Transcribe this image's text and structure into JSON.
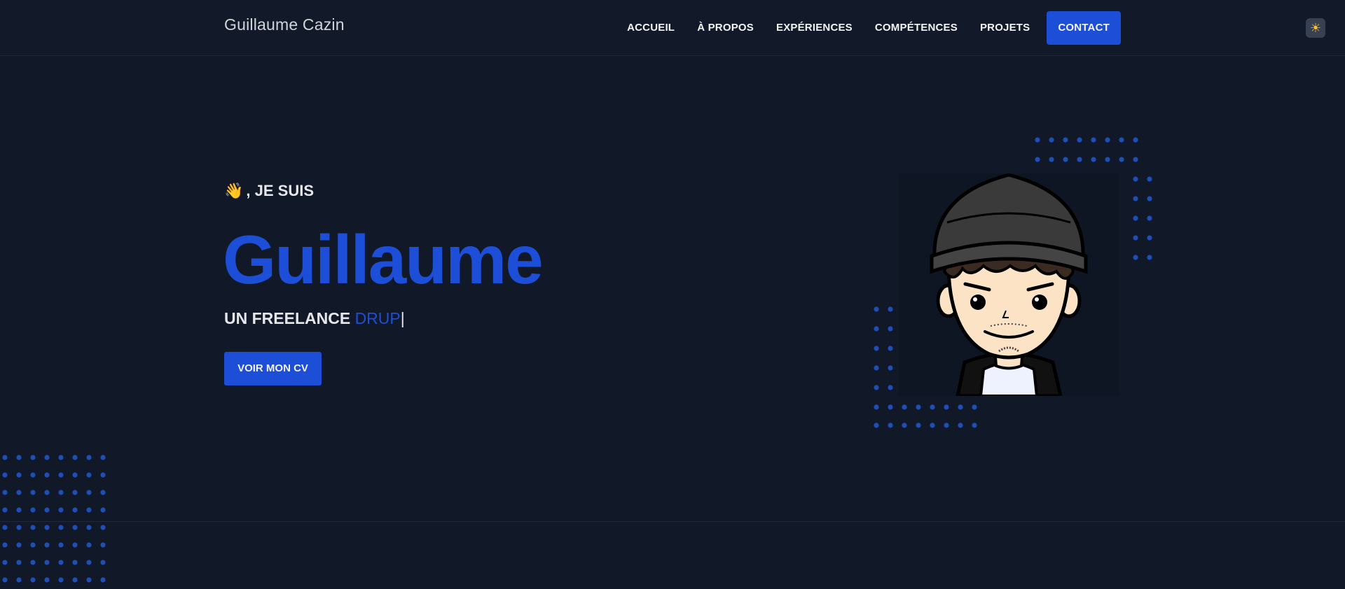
{
  "header": {
    "brand": "Guillaume Cazin",
    "nav": [
      {
        "label": "ACCUEIL"
      },
      {
        "label": "À PROPOS"
      },
      {
        "label": "EXPÉRIENCES"
      },
      {
        "label": "COMPÉTENCES"
      },
      {
        "label": "PROJETS"
      },
      {
        "label": "CONTACT"
      }
    ],
    "theme_toggle_icon": "sun-icon"
  },
  "hero": {
    "greeting_emoji": "👋",
    "greeting": ", JE SUIS",
    "name": "Guillaume",
    "subtitle_prefix": "UN FREELANCE ",
    "subtitle_typed": "DRUP",
    "cursor": "|",
    "cv_button": "VOIR MON CV",
    "avatar": "avatar-illustration"
  },
  "colors": {
    "background": "#111827",
    "accent": "#1d4ed8",
    "dots": "#1e4fb8"
  }
}
